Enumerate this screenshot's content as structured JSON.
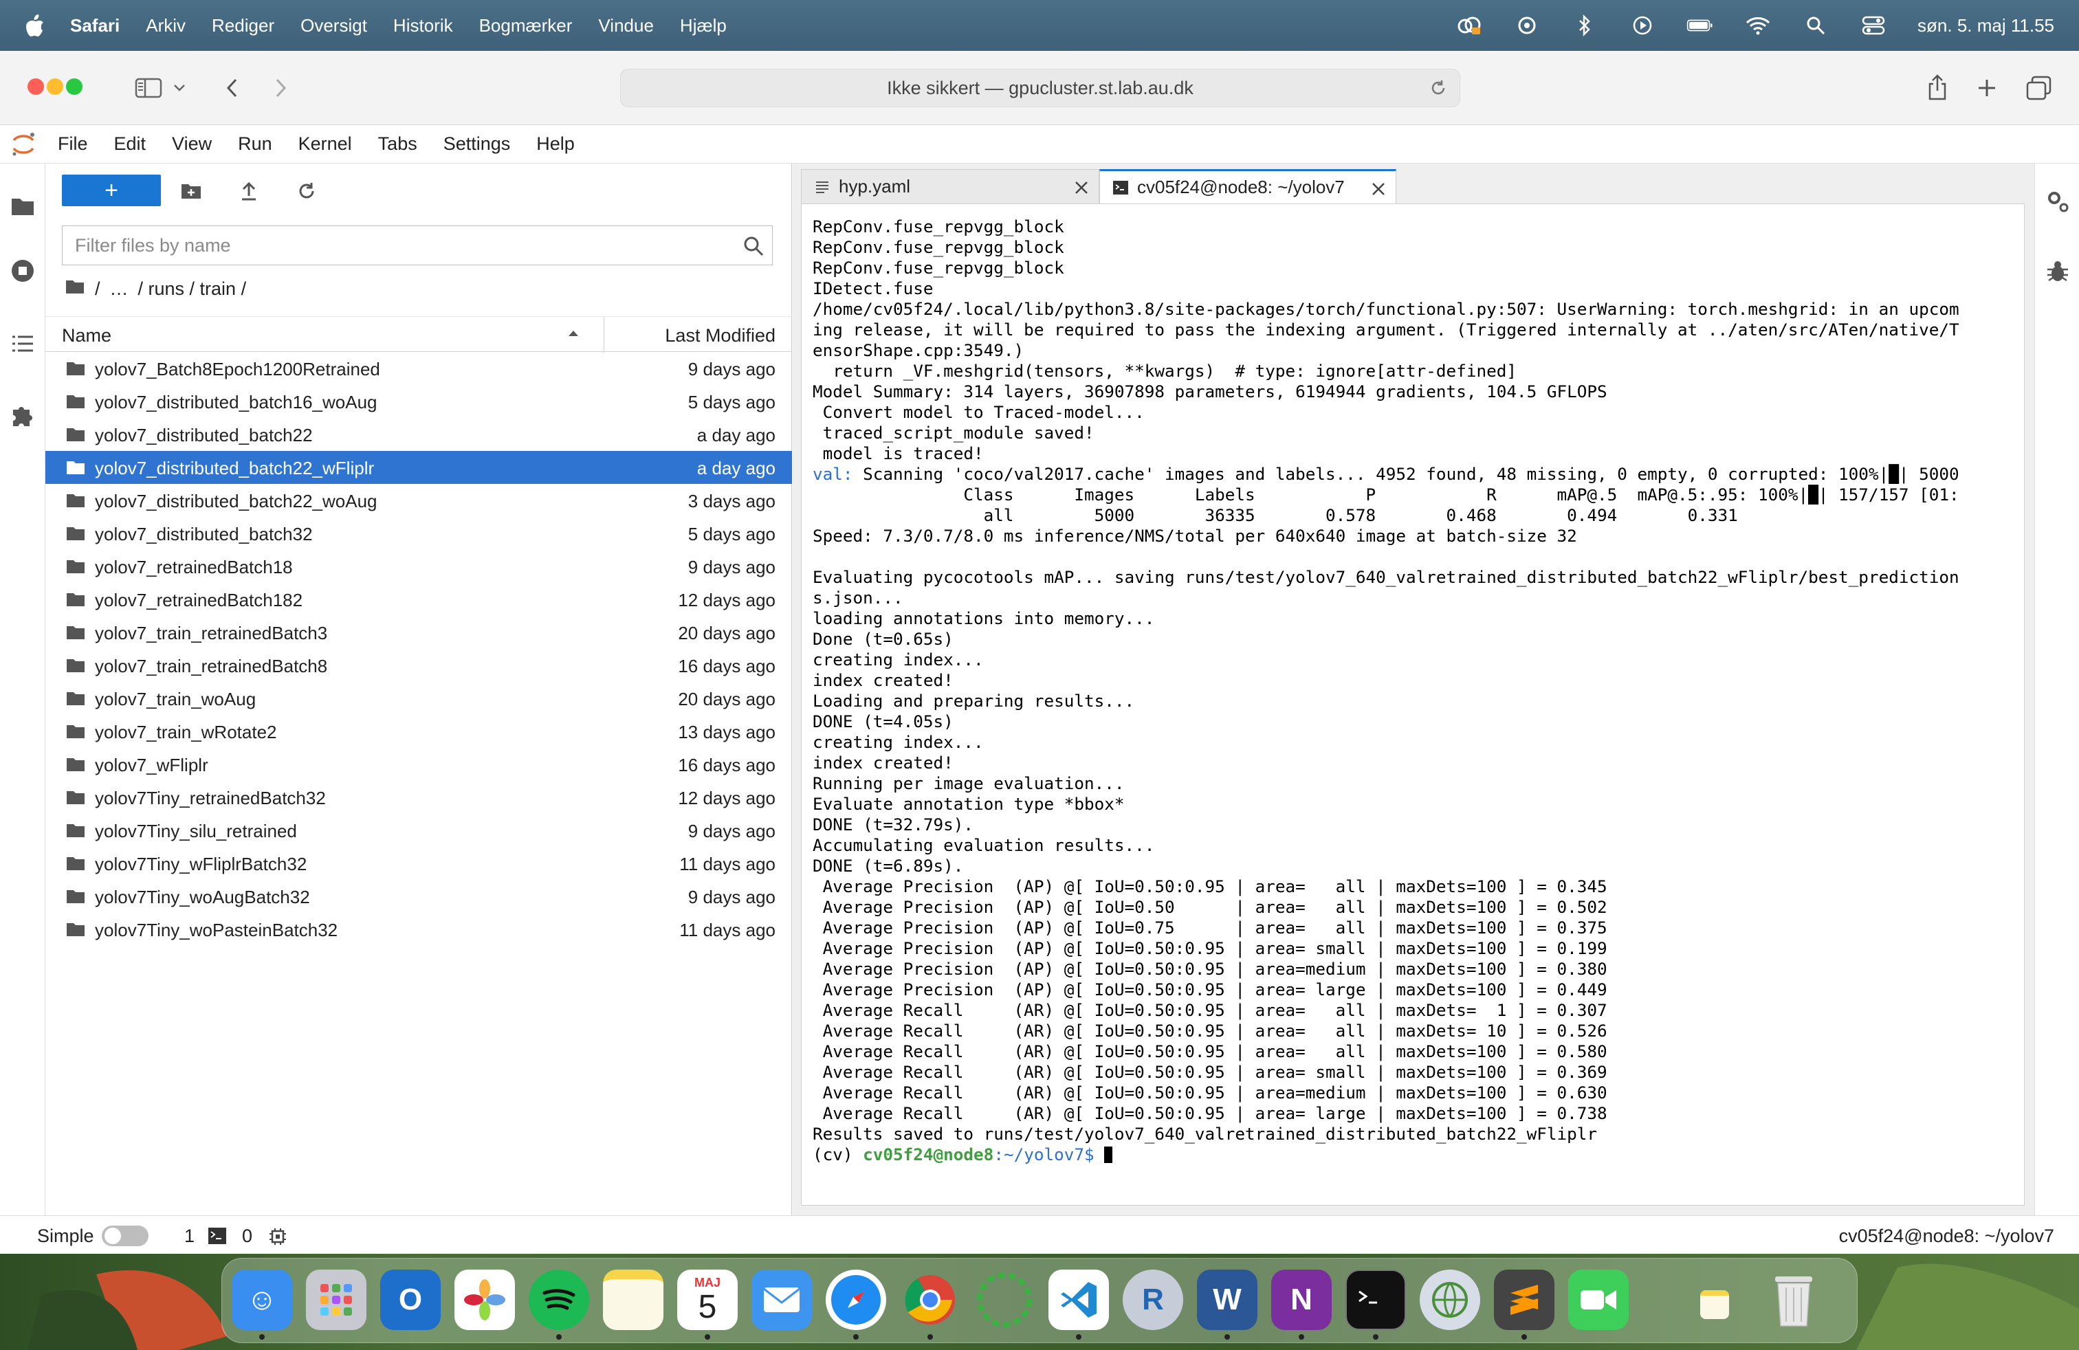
{
  "menubar": {
    "items": [
      "Safari",
      "Arkiv",
      "Rediger",
      "Oversigt",
      "Historik",
      "Bogmærker",
      "Vindue",
      "Hjælp"
    ],
    "clock": "søn. 5. maj  11.55"
  },
  "browser": {
    "address": "Ikke sikkert — gpucluster.st.lab.au.dk"
  },
  "jupyter": {
    "menu": [
      "File",
      "Edit",
      "View",
      "Run",
      "Kernel",
      "Tabs",
      "Settings",
      "Help"
    ],
    "filebrowser": {
      "new_label": "+",
      "filter_placeholder": "Filter files by name",
      "breadcrumb": [
        "/",
        "…",
        "/ runs / train /"
      ],
      "col_name": "Name",
      "col_modified": "Last Modified",
      "files": [
        {
          "name": "yolov7_Batch8Epoch1200Retrained",
          "modified": "9 days ago"
        },
        {
          "name": "yolov7_distributed_batch16_woAug",
          "modified": "5 days ago"
        },
        {
          "name": "yolov7_distributed_batch22",
          "modified": "a day ago"
        },
        {
          "name": "yolov7_distributed_batch22_wFliplr",
          "modified": "a day ago"
        },
        {
          "name": "yolov7_distributed_batch22_woAug",
          "modified": "3 days ago"
        },
        {
          "name": "yolov7_distributed_batch32",
          "modified": "5 days ago"
        },
        {
          "name": "yolov7_retrainedBatch18",
          "modified": "9 days ago"
        },
        {
          "name": "yolov7_retrainedBatch182",
          "modified": "12 days ago"
        },
        {
          "name": "yolov7_train_retrainedBatch3",
          "modified": "20 days ago"
        },
        {
          "name": "yolov7_train_retrainedBatch8",
          "modified": "16 days ago"
        },
        {
          "name": "yolov7_train_woAug",
          "modified": "20 days ago"
        },
        {
          "name": "yolov7_train_wRotate2",
          "modified": "13 days ago"
        },
        {
          "name": "yolov7_wFliplr",
          "modified": "16 days ago"
        },
        {
          "name": "yolov7Tiny_retrainedBatch32",
          "modified": "12 days ago"
        },
        {
          "name": "yolov7Tiny_silu_retrained",
          "modified": "9 days ago"
        },
        {
          "name": "yolov7Tiny_wFliplrBatch32",
          "modified": "11 days ago"
        },
        {
          "name": "yolov7Tiny_woAugBatch32",
          "modified": "9 days ago"
        },
        {
          "name": "yolov7Tiny_woPasteinBatch32",
          "modified": "11 days ago"
        }
      ],
      "selected_index": 3
    },
    "tabs": [
      {
        "label": "hyp.yaml",
        "active": false
      },
      {
        "label": "cv05f24@node8: ~/yolov7",
        "active": true
      }
    ],
    "terminal": {
      "lines_before": "RepConv.fuse_repvgg_block\nRepConv.fuse_repvgg_block\nRepConv.fuse_repvgg_block\nIDetect.fuse\n/home/cv05f24/.local/lib/python3.8/site-packages/torch/functional.py:507: UserWarning: torch.meshgrid: in an upcom\ning release, it will be required to pass the indexing argument. (Triggered internally at ../aten/src/ATen/native/T\nensorShape.cpp:3549.)\n  return _VF.meshgrid(tensors, **kwargs)  # type: ignore[attr-defined]\nModel Summary: 314 layers, 36907898 parameters, 6194944 gradients, 104.5 GFLOPS\n Convert model to Traced-model...\n traced_script_module saved!\n model is traced!\n",
      "val_prefix": "val:",
      "val_line": " Scanning 'coco/val2017.cache' images and labels... 4952 found, 48 missing, 0 empty, 0 corrupted: 100%|█| 5000",
      "lines_after": "               Class      Images      Labels           P           R      mAP@.5  mAP@.5:.95: 100%|█| 157/157 [01:\n                 all        5000       36335       0.578       0.468       0.494       0.331\nSpeed: 7.3/0.7/8.0 ms inference/NMS/total per 640x640 image at batch-size 32\n\nEvaluating pycocotools mAP... saving runs/test/yolov7_640_valretrained_distributed_batch22_wFliplr/best_prediction\ns.json...\nloading annotations into memory...\nDone (t=0.65s)\ncreating index...\nindex created!\nLoading and preparing results...\nDONE (t=4.05s)\ncreating index...\nindex created!\nRunning per image evaluation...\nEvaluate annotation type *bbox*\nDONE (t=32.79s).\nAccumulating evaluation results...\nDONE (t=6.89s).\n Average Precision  (AP) @[ IoU=0.50:0.95 | area=   all | maxDets=100 ] = 0.345\n Average Precision  (AP) @[ IoU=0.50      | area=   all | maxDets=100 ] = 0.502\n Average Precision  (AP) @[ IoU=0.75      | area=   all | maxDets=100 ] = 0.375\n Average Precision  (AP) @[ IoU=0.50:0.95 | area= small | maxDets=100 ] = 0.199\n Average Precision  (AP) @[ IoU=0.50:0.95 | area=medium | maxDets=100 ] = 0.380\n Average Precision  (AP) @[ IoU=0.50:0.95 | area= large | maxDets=100 ] = 0.449\n Average Recall     (AR) @[ IoU=0.50:0.95 | area=   all | maxDets=  1 ] = 0.307\n Average Recall     (AR) @[ IoU=0.50:0.95 | area=   all | maxDets= 10 ] = 0.526\n Average Recall     (AR) @[ IoU=0.50:0.95 | area=   all | maxDets=100 ] = 0.580\n Average Recall     (AR) @[ IoU=0.50:0.95 | area= small | maxDets=100 ] = 0.369\n Average Recall     (AR) @[ IoU=0.50:0.95 | area=medium | maxDets=100 ] = 0.630\n Average Recall     (AR) @[ IoU=0.50:0.95 | area= large | maxDets=100 ] = 0.738\nResults saved to runs/test/yolov7_640_valretrained_distributed_batch22_wFliplr\n",
      "prompt_env": "(cv) ",
      "prompt_user": "cv05f24@node8",
      "prompt_path": ":~/yolov7$ "
    },
    "statusbar": {
      "mode": "Simple",
      "terminals_count": "1",
      "kernels_count": "0",
      "right": "cv05f24@node8: ~/yolov7"
    }
  },
  "dock": {
    "apps": [
      "finder-icon",
      "launchpad-icon",
      "outlook-icon",
      "photos-icon",
      "spotify-icon",
      "notes-icon",
      "calendar-icon",
      "mail-icon",
      "safari-icon",
      "chrome-icon",
      "activity-icon",
      "vscode-icon",
      "r-icon",
      "word-icon",
      "onenote-icon",
      "terminal-icon",
      "vpn-icon",
      "sublime-icon",
      "facetime-icon",
      "notes-mini-icon",
      "trash-icon"
    ],
    "calendar_month": "MAJ",
    "calendar_day": "5"
  },
  "colors": {
    "accent": "#1976d2",
    "selected_row": "#2f74d0",
    "terminal_val": "#2a6fd6",
    "prompt_green": "#3ca03c"
  }
}
